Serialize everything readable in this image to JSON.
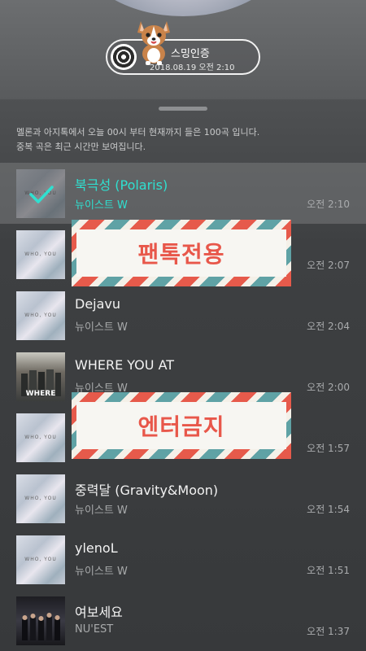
{
  "header": {
    "stream_badge_title": "스밍인증",
    "stream_badge_time": "2018.08.19 오전 2:10"
  },
  "notice": {
    "line1": "멜론과 아지톡에서 오늘 00시 부터 현재까지 들은 100곡 입니다.",
    "line2": "중복 곡은 최근 시간만 보여집니다."
  },
  "tracks": [
    {
      "title": "북극성 (Polaris)",
      "artist": "뉴이스트 W",
      "time": "오전 2:10",
      "selected": true
    },
    {
      "title": "",
      "artist": "",
      "time": "오전 2:07"
    },
    {
      "title": "Dejavu",
      "artist": "뉴이스트 W",
      "time": "오전 2:04"
    },
    {
      "title": "WHERE YOU AT",
      "artist": "뉴이스트 W",
      "time": "오전 2:00"
    },
    {
      "title": "",
      "artist": "",
      "time": "오전 1:57"
    },
    {
      "title": "중력달 (Gravity&Moon)",
      "artist": "뉴이스트 W",
      "time": "오전 1:54"
    },
    {
      "title": "ylenoL",
      "artist": "뉴이스트 W",
      "time": "오전 1:51"
    },
    {
      "title": "여보세요",
      "artist": "NU'EST",
      "time": "오전 1:37"
    }
  ],
  "album_art_text": {
    "wn": "WHO, YOU",
    "where": "WHERE"
  },
  "stickers": {
    "first": "팬톡전용",
    "second": "엔터금지"
  },
  "colors": {
    "accent": "#2fe0d0",
    "sticker_red": "#e65a4b",
    "sticker_teal": "#5fa2a5"
  }
}
